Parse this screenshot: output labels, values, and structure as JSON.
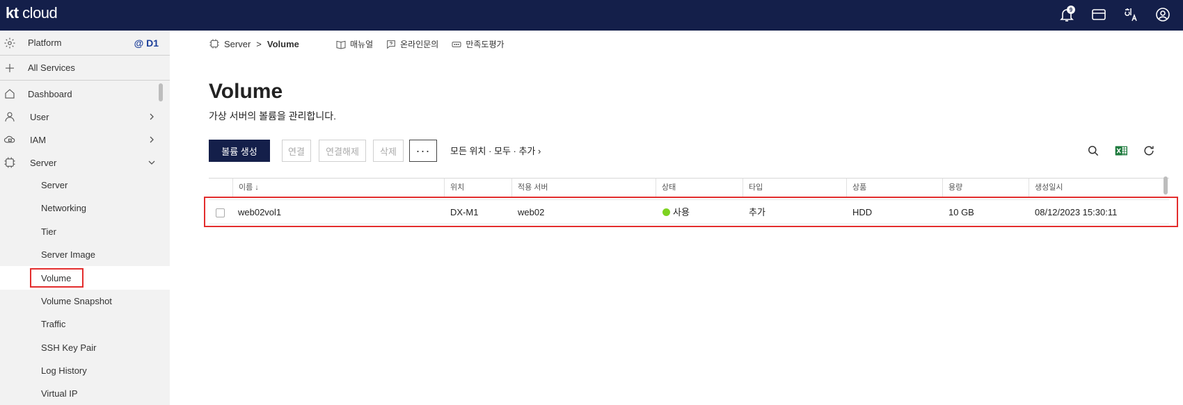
{
  "app": {
    "logo_bold": "kt",
    "logo_rest": " cloud",
    "notification_count": "9"
  },
  "sidebar": {
    "platform_label": "Platform",
    "zone": "@ D1",
    "all_services": "All Services",
    "menus": [
      {
        "label": "Dashboard"
      },
      {
        "label": "User"
      },
      {
        "label": "IAM"
      },
      {
        "label": "Server"
      }
    ],
    "server_items": [
      "Server",
      "Networking",
      "Tier",
      "Server Image",
      "Volume",
      "Volume Snapshot",
      "Traffic",
      "SSH Key Pair",
      "Log History",
      "Virtual IP"
    ],
    "active_item": "Volume"
  },
  "breadcrumb": {
    "parent": "Server",
    "separator": ">",
    "current": "Volume"
  },
  "links": {
    "manual": "매뉴얼",
    "inquiry": "온라인문의",
    "survey": "만족도평가"
  },
  "page": {
    "title": "Volume",
    "subtitle": "가상 서버의 볼륨을 관리합니다."
  },
  "toolbar": {
    "create": "볼륨 생성",
    "attach": "연결",
    "detach": "연결해제",
    "delete": "삭제",
    "more": "···",
    "filter": "모든 위치 · 모두 · 추가 ›"
  },
  "table": {
    "headers": [
      "이름 ↓",
      "위치",
      "적용 서버",
      "상태",
      "타입",
      "상품",
      "용량",
      "생성일시"
    ],
    "rows": [
      {
        "name": "web02vol1",
        "location": "DX-M1",
        "server": "web02",
        "status": "사용",
        "type": "추가",
        "product": "HDD",
        "size": "10 GB",
        "created": "08/12/2023 15:30:11"
      }
    ]
  },
  "colors": {
    "topbar": "#141f4a",
    "accent": "#1c3f9a",
    "highlight": "#e32d2d",
    "status_ok": "#7ed321"
  }
}
